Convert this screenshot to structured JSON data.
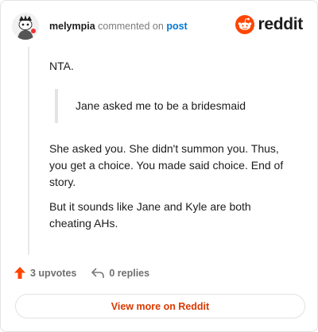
{
  "header": {
    "username": "melympia",
    "action_text": "commented on",
    "post_link": "post",
    "brand": "reddit"
  },
  "comment": {
    "paragraph_1": "NTA.",
    "quote": "Jane asked me to be a bridesmaid",
    "paragraph_2": "She asked you. She didn't summon you. Thus, you get a choice. You made said choice. End of story.",
    "paragraph_3": "But it sounds like Jane and Kyle are both cheating AHs."
  },
  "actions": {
    "upvotes": "3 upvotes",
    "replies": "0 replies"
  },
  "footer": {
    "view_more": "View more on Reddit"
  },
  "colors": {
    "brand_orange": "#ff4500",
    "link_blue": "#0079d3",
    "view_more_text": "#d93900"
  },
  "icons": [
    "avatar",
    "reddit-logo-icon",
    "upvote-arrow-icon",
    "reply-icon"
  ]
}
